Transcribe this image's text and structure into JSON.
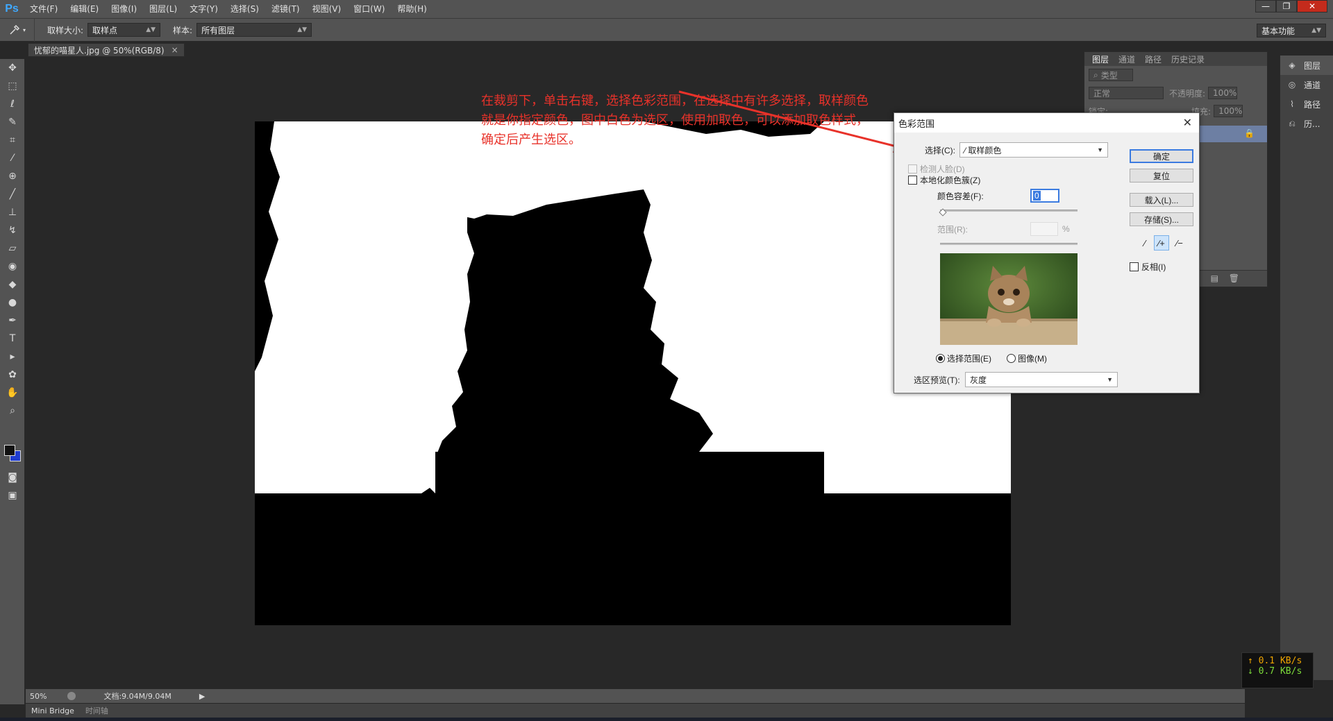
{
  "app": {
    "logo": "Ps"
  },
  "menu": [
    "文件(F)",
    "编辑(E)",
    "图像(I)",
    "图层(L)",
    "文字(Y)",
    "选择(S)",
    "滤镜(T)",
    "视图(V)",
    "窗口(W)",
    "帮助(H)"
  ],
  "options": {
    "sample_size_label": "取样大小:",
    "sample_size_value": "取样点",
    "sample_label": "样本:",
    "sample_value": "所有图层",
    "workspace": "基本功能"
  },
  "document_tab": {
    "title": "忧郁的喵星人.jpg @ 50%(RGB/8)",
    "close": "×"
  },
  "annotation": {
    "line1": "在裁剪下，单击右键，选择色彩范围，在选择中有许多选择，取样颜色",
    "line2": "就是你指定颜色，图中白色为选区，使用加取色，可以添加取色样式，",
    "line3": "确定后产生选区。"
  },
  "status": {
    "zoom": "50%",
    "doc": "文档:9.04M/9.04M"
  },
  "bottom_tabs": [
    "Mini Bridge",
    "时间轴"
  ],
  "layers_panel": {
    "tabs": [
      "图层",
      "通道",
      "路径",
      "历史记录"
    ],
    "filter": "类型",
    "blend_mode": "正常",
    "opacity_label": "不透明度:",
    "opacity_value": "100%",
    "lock_label": "锁定:",
    "fill_label": "填充:",
    "fill_value": "100%"
  },
  "dock": [
    "图层",
    "通道",
    "路径",
    "历..."
  ],
  "network": {
    "up": "↑ 0.1 KB/s",
    "down": "↓ 0.7 KB/s"
  },
  "dialog": {
    "title": "色彩范围",
    "select_label": "选择(C):",
    "select_value": "取样颜色",
    "detect_faces": "检测人脸(D)",
    "localized": "本地化颜色簇(Z)",
    "fuzziness_label": "颜色容差(F):",
    "fuzziness_value": "0",
    "range_label": "范围(R):",
    "range_unit": "%",
    "radio_selection": "选择范围(E)",
    "radio_image": "图像(M)",
    "preview_label": "选区预览(T):",
    "preview_value": "灰度",
    "buttons": {
      "ok": "确定",
      "reset": "复位",
      "load": "载入(L)...",
      "save": "存储(S)..."
    },
    "invert": "反相(I)"
  },
  "colors": {
    "annotation": "#e8322a",
    "foreground": "#111111",
    "background": "#1f3ccf",
    "accent": "#3b7be0"
  }
}
